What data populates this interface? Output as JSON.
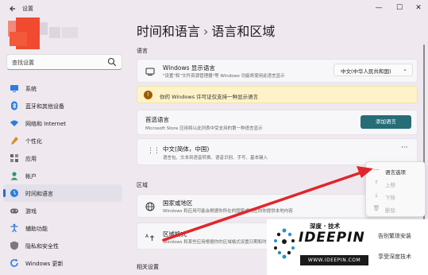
{
  "window": {
    "title": "设置"
  },
  "search": {
    "placeholder": "查找设置"
  },
  "nav": [
    {
      "label": "系统",
      "icon": "monitor-icon",
      "color": "#2b7de0"
    },
    {
      "label": "蓝牙和其他设备",
      "icon": "bluetooth-icon",
      "color": "#2b7de0"
    },
    {
      "label": "网络和 Internet",
      "icon": "wifi-icon",
      "color": "#2b7de0"
    },
    {
      "label": "个性化",
      "icon": "brush-icon",
      "color": "#d98b2b"
    },
    {
      "label": "应用",
      "icon": "apps-icon",
      "color": "#555555"
    },
    {
      "label": "帐户",
      "icon": "person-icon",
      "color": "#2b9a6a"
    },
    {
      "label": "时间和语言",
      "icon": "globe-clock-icon",
      "color": "#2b7de0",
      "active": true
    },
    {
      "label": "游戏",
      "icon": "gamepad-icon",
      "color": "#555555"
    },
    {
      "label": "辅助功能",
      "icon": "accessibility-icon",
      "color": "#2b7de0"
    },
    {
      "label": "隐私和安全性",
      "icon": "shield-icon",
      "color": "#777777"
    },
    {
      "label": "Windows 更新",
      "icon": "update-icon",
      "color": "#2b7de0"
    }
  ],
  "breadcrumb": {
    "parent": "时间和语言",
    "separator": "›",
    "current": "语言和区域"
  },
  "language_section": {
    "heading": "语言"
  },
  "display_language": {
    "title": "Windows 显示语言",
    "subtitle": "\"设置\"和\"文件资源管理器\"等 Windows 功能将使用此语言显示",
    "value": "中文(中华人民共和国)"
  },
  "license_notice": {
    "text": "你的 Windows 许可证仅支持一种显示语言"
  },
  "preferred_languages": {
    "title": "首选语言",
    "subtitle": "Microsoft Store 应用将以此列表中受支持的第一种语言显示",
    "add_button": "添加语言"
  },
  "language_entry": {
    "title": "中文(简体，中国)",
    "subtitle": "语言包、文本到语音转换、语音识别、手写、基本键入",
    "more": "···"
  },
  "context_menu": [
    {
      "label": "语言选项",
      "icon": "···",
      "enabled": true
    },
    {
      "label": "上移",
      "icon": "↑",
      "enabled": false
    },
    {
      "label": "下移",
      "icon": "↓",
      "enabled": false
    },
    {
      "label": "删除",
      "icon": "🗑",
      "enabled": false
    }
  ],
  "region_section": {
    "heading": "区域"
  },
  "country_region": {
    "title": "国家或地区",
    "subtitle": "Windows 和应用可能会根据你所在的国家或地区向你提供本地内容"
  },
  "regional_format": {
    "title": "区域格式",
    "subtitle": "Windows 和某些应用根据你的区域格式设置日期和时间格式"
  },
  "related_section": {
    "heading": "相关设置"
  },
  "watermark": {
    "brand_cn": "深度 · 技术",
    "brand_en": "IDEEPIN",
    "url": "WWW.IDEEPIN.COM",
    "right_top": "告别繁琐安装",
    "right_bottom": "享受深度技术"
  },
  "colors": {
    "accent": "#266d76",
    "arrow": "#e0262b",
    "warning_bg": "#fdf2c8"
  }
}
